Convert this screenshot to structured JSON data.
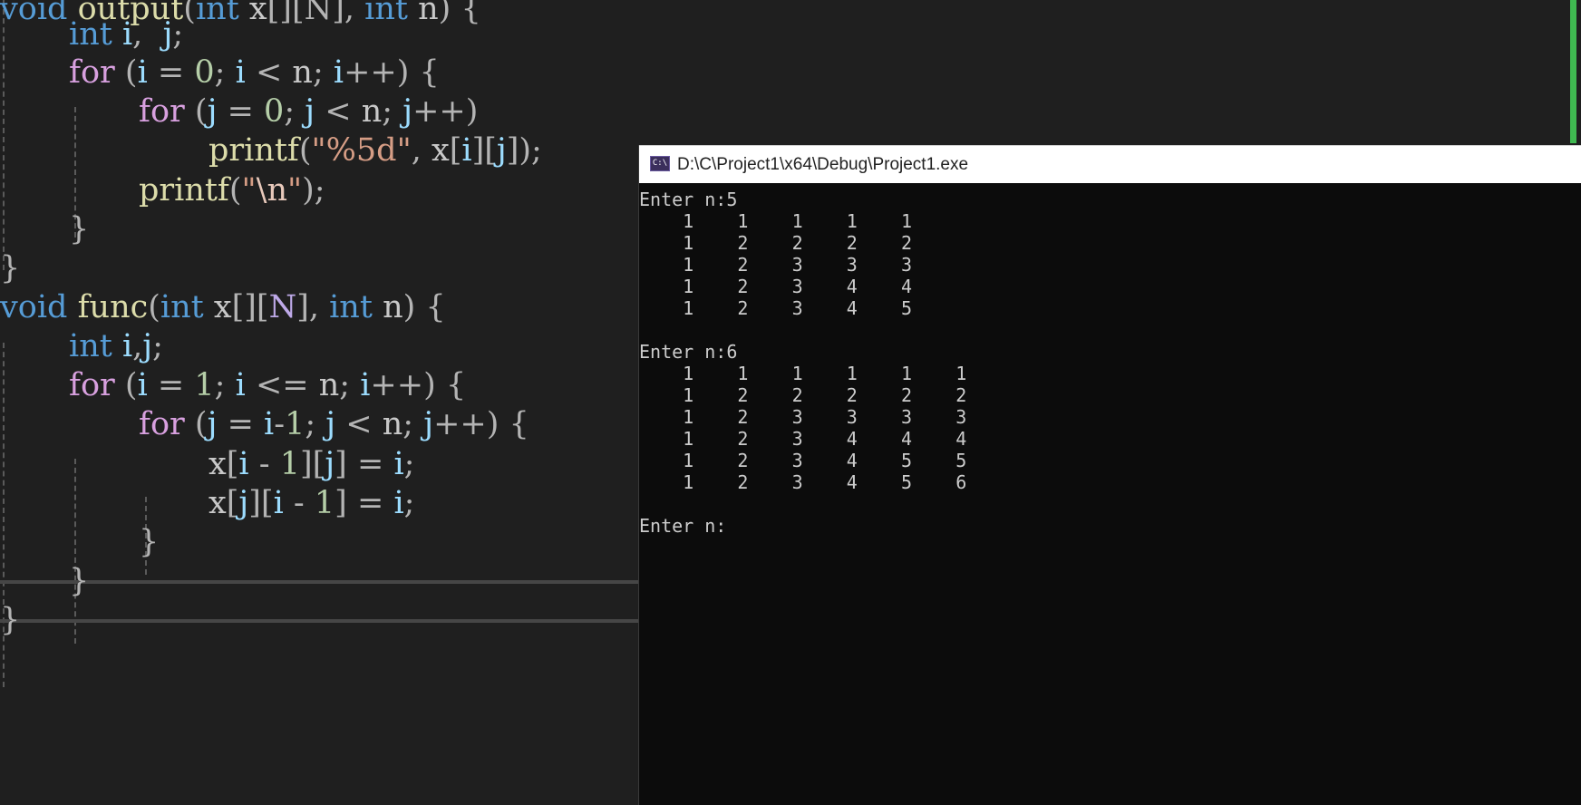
{
  "editor": {
    "lines": [
      [
        [
          "kw",
          "void"
        ],
        [
          "plain",
          " "
        ],
        [
          "fn",
          "output"
        ],
        [
          "pun",
          "("
        ],
        [
          "kw",
          "int"
        ],
        [
          "plain",
          " "
        ],
        [
          "plain",
          "x"
        ],
        [
          "pun",
          "[][N],"
        ],
        [
          "plain",
          " "
        ],
        [
          "kw",
          "int"
        ],
        [
          "plain",
          " "
        ],
        [
          "plain",
          "n"
        ],
        [
          "pun",
          ")"
        ],
        [
          "plain",
          " "
        ],
        [
          "pun",
          "{"
        ]
      ],
      [
        [
          "kw",
          "int"
        ],
        [
          "plain",
          " "
        ],
        [
          "var",
          "i"
        ],
        [
          "pun",
          ","
        ],
        [
          "plain",
          "  "
        ],
        [
          "var",
          "j"
        ],
        [
          "pun",
          ";"
        ]
      ],
      [
        [
          "ctl",
          "for"
        ],
        [
          "plain",
          " "
        ],
        [
          "pun",
          "("
        ],
        [
          "var",
          "i"
        ],
        [
          "plain",
          " "
        ],
        [
          "pun",
          "="
        ],
        [
          "plain",
          " "
        ],
        [
          "num",
          "0"
        ],
        [
          "pun",
          ";"
        ],
        [
          "plain",
          " "
        ],
        [
          "var",
          "i"
        ],
        [
          "plain",
          " "
        ],
        [
          "pun",
          "<"
        ],
        [
          "plain",
          " "
        ],
        [
          "plain",
          "n"
        ],
        [
          "pun",
          ";"
        ],
        [
          "plain",
          " "
        ],
        [
          "var",
          "i"
        ],
        [
          "pun",
          "++)"
        ],
        [
          "plain",
          " "
        ],
        [
          "pun",
          "{"
        ]
      ],
      [
        [
          "ctl",
          "for"
        ],
        [
          "plain",
          " "
        ],
        [
          "pun",
          "("
        ],
        [
          "var",
          "j"
        ],
        [
          "plain",
          " "
        ],
        [
          "pun",
          "="
        ],
        [
          "plain",
          " "
        ],
        [
          "num",
          "0"
        ],
        [
          "pun",
          ";"
        ],
        [
          "plain",
          " "
        ],
        [
          "var",
          "j"
        ],
        [
          "plain",
          " "
        ],
        [
          "pun",
          "<"
        ],
        [
          "plain",
          " "
        ],
        [
          "plain",
          "n"
        ],
        [
          "pun",
          ";"
        ],
        [
          "plain",
          " "
        ],
        [
          "var",
          "j"
        ],
        [
          "pun",
          "++)"
        ]
      ],
      [
        [
          "fn",
          "printf"
        ],
        [
          "pun",
          "("
        ],
        [
          "str",
          "\"%5d\""
        ],
        [
          "pun",
          ","
        ],
        [
          "plain",
          " "
        ],
        [
          "plain",
          "x"
        ],
        [
          "pun",
          "["
        ],
        [
          "var",
          "i"
        ],
        [
          "pun",
          "]["
        ],
        [
          "var",
          "j"
        ],
        [
          "pun",
          "]);"
        ]
      ],
      [
        [
          "fn",
          "printf"
        ],
        [
          "pun",
          "("
        ],
        [
          "str",
          "\""
        ],
        [
          "esc",
          "\\n"
        ],
        [
          "str",
          "\""
        ],
        [
          "pun",
          ");"
        ]
      ],
      [
        [
          "pun",
          "}"
        ]
      ],
      [
        [
          "pun",
          "}"
        ]
      ],
      [
        [
          "kw",
          "void"
        ],
        [
          "plain",
          " "
        ],
        [
          "fn",
          "func"
        ],
        [
          "pun",
          "("
        ],
        [
          "kw",
          "int"
        ],
        [
          "plain",
          " "
        ],
        [
          "plain",
          "x"
        ],
        [
          "pun",
          "[]["
        ],
        [
          "mac",
          "N"
        ],
        [
          "pun",
          "],"
        ],
        [
          "plain",
          " "
        ],
        [
          "kw",
          "int"
        ],
        [
          "plain",
          " "
        ],
        [
          "plain",
          "n"
        ],
        [
          "pun",
          ")"
        ],
        [
          "plain",
          " "
        ],
        [
          "pun",
          "{"
        ]
      ],
      [
        [
          "kw",
          "int"
        ],
        [
          "plain",
          " "
        ],
        [
          "var",
          "i"
        ],
        [
          "pun",
          ","
        ],
        [
          "var",
          "j"
        ],
        [
          "pun",
          ";"
        ]
      ],
      [
        [
          "ctl",
          "for"
        ],
        [
          "plain",
          " "
        ],
        [
          "pun",
          "("
        ],
        [
          "var",
          "i"
        ],
        [
          "plain",
          " "
        ],
        [
          "pun",
          "="
        ],
        [
          "plain",
          " "
        ],
        [
          "num",
          "1"
        ],
        [
          "pun",
          ";"
        ],
        [
          "plain",
          " "
        ],
        [
          "var",
          "i"
        ],
        [
          "plain",
          " "
        ],
        [
          "pun",
          "<="
        ],
        [
          "plain",
          " "
        ],
        [
          "plain",
          "n"
        ],
        [
          "pun",
          ";"
        ],
        [
          "plain",
          " "
        ],
        [
          "var",
          "i"
        ],
        [
          "pun",
          "++)"
        ],
        [
          "plain",
          " "
        ],
        [
          "pun",
          "{"
        ]
      ],
      [
        [
          "ctl",
          "for"
        ],
        [
          "plain",
          " "
        ],
        [
          "pun",
          "("
        ],
        [
          "var",
          "j"
        ],
        [
          "plain",
          " "
        ],
        [
          "pun",
          "="
        ],
        [
          "plain",
          " "
        ],
        [
          "var",
          "i"
        ],
        [
          "pun",
          "-"
        ],
        [
          "num",
          "1"
        ],
        [
          "pun",
          ";"
        ],
        [
          "plain",
          " "
        ],
        [
          "var",
          "j"
        ],
        [
          "plain",
          " "
        ],
        [
          "pun",
          "<"
        ],
        [
          "plain",
          " "
        ],
        [
          "plain",
          "n"
        ],
        [
          "pun",
          ";"
        ],
        [
          "plain",
          " "
        ],
        [
          "var",
          "j"
        ],
        [
          "pun",
          "++)"
        ],
        [
          "plain",
          " "
        ],
        [
          "pun",
          "{"
        ]
      ],
      [
        [
          "plain",
          "x"
        ],
        [
          "pun",
          "["
        ],
        [
          "var",
          "i"
        ],
        [
          "plain",
          " "
        ],
        [
          "pun",
          "-"
        ],
        [
          "plain",
          " "
        ],
        [
          "num",
          "1"
        ],
        [
          "pun",
          "]["
        ],
        [
          "var",
          "j"
        ],
        [
          "pun",
          "]"
        ],
        [
          "plain",
          " "
        ],
        [
          "pun",
          "="
        ],
        [
          "plain",
          " "
        ],
        [
          "var",
          "i"
        ],
        [
          "pun",
          ";"
        ]
      ],
      [
        [
          "plain",
          "x"
        ],
        [
          "pun",
          "["
        ],
        [
          "var",
          "j"
        ],
        [
          "pun",
          "]["
        ],
        [
          "var",
          "i"
        ],
        [
          "plain",
          " "
        ],
        [
          "pun",
          "-"
        ],
        [
          "plain",
          " "
        ],
        [
          "num",
          "1"
        ],
        [
          "pun",
          "]"
        ],
        [
          "plain",
          " "
        ],
        [
          "pun",
          "="
        ],
        [
          "plain",
          " "
        ],
        [
          "var",
          "i"
        ],
        [
          "pun",
          ";"
        ]
      ],
      [
        [
          "pun",
          "}"
        ]
      ],
      [
        [
          "pun",
          "}"
        ]
      ],
      [
        [
          "pun",
          "}"
        ]
      ]
    ]
  },
  "console": {
    "icon_label": "C:\\",
    "title": "D:\\C\\Project1\\x64\\Debug\\Project1.exe",
    "output_lines": [
      "Enter n:5",
      "    1    1    1    1    1",
      "    1    2    2    2    2",
      "    1    2    3    3    3",
      "    1    2    3    4    4",
      "    1    2    3    4    5",
      "",
      "Enter n:6",
      "    1    1    1    1    1    1",
      "    1    2    2    2    2    2",
      "    1    2    3    3    3    3",
      "    1    2    3    4    4    4",
      "    1    2    3    4    5    5",
      "    1    2    3    4    5    6",
      "",
      "Enter n:"
    ]
  },
  "colors": {
    "editor_background": "#1f1f1f",
    "console_background": "#0c0c0c",
    "scrollbar_accent": "#3fb950"
  }
}
